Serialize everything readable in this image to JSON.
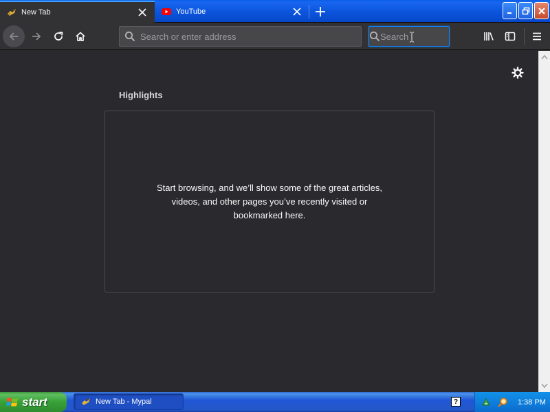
{
  "tabs": [
    {
      "label": "New Tab",
      "active": true,
      "icon": "mypal-icon"
    },
    {
      "label": "YouTube",
      "active": false,
      "icon": "youtube-icon"
    }
  ],
  "navbar": {
    "url_placeholder": "Search or enter address",
    "search_placeholder": "Search"
  },
  "content": {
    "section_title": "Highlights",
    "empty_message": "Start browsing, and we’ll show some of the great articles, videos, and other pages you’ve recently visited or bookmarked here."
  },
  "taskbar": {
    "start_label": "start",
    "task_label": "New Tab - Mypal",
    "help_glyph": "?",
    "clock": "1:38 PM"
  },
  "colors": {
    "accent": "#0a84ff",
    "content_bg": "#2a2a2e",
    "toolbar_bg": "#323234",
    "taskbar_blue": "#2457c7",
    "start_green": "#37a137"
  }
}
